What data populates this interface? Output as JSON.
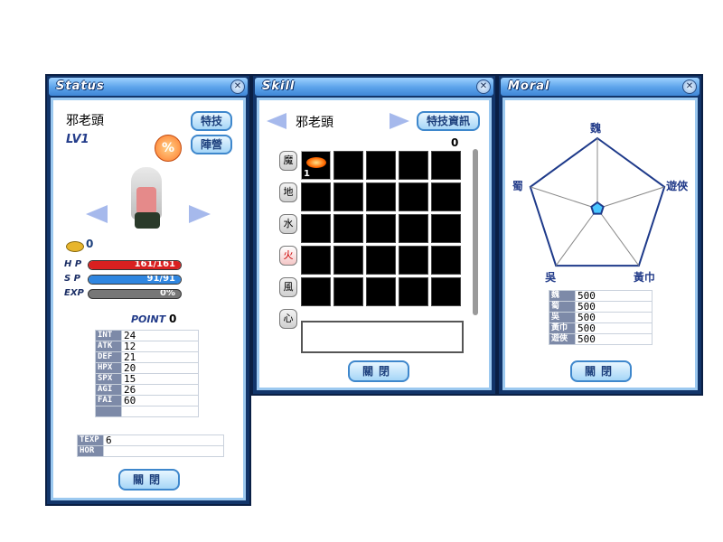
{
  "status": {
    "title": "Status",
    "name": "邪老頭",
    "level": "LV1",
    "btn_special": "特技",
    "btn_camp": "陣營",
    "gold": "0",
    "hp_label": "H P",
    "hp_text": "161/161",
    "hp_ratio": 1.0,
    "sp_label": "S P",
    "sp_text": "91/91",
    "sp_ratio": 1.0,
    "exp_label": "EXP",
    "exp_text": "0%",
    "exp_ratio": 0.0,
    "point_label": "POINT",
    "point_value": "0",
    "stats": [
      {
        "k": "INT",
        "v": "24"
      },
      {
        "k": "ATK",
        "v": "12"
      },
      {
        "k": "DEF",
        "v": "21"
      },
      {
        "k": "HPX",
        "v": "20"
      },
      {
        "k": "SPX",
        "v": "15"
      },
      {
        "k": "AGI",
        "v": "26"
      },
      {
        "k": "FAI",
        "v": "60"
      },
      {
        "k": "",
        "v": ""
      }
    ],
    "texp_label": "TEXP",
    "texp_value": "6",
    "hor_label": "HOR",
    "hor_value": "",
    "close": "關閉"
  },
  "skill": {
    "title": "Skill",
    "name": "邪老頭",
    "btn_info": "特技資訊",
    "count": "0",
    "slot_count": "1",
    "tabs": [
      "魔",
      "地",
      "水",
      "火",
      "風",
      "心"
    ],
    "active_tab": "火",
    "close": "關閉"
  },
  "moral": {
    "title": "Moral",
    "axes": [
      "魏",
      "遊俠",
      "黃巾",
      "吳",
      "蜀"
    ],
    "table": [
      {
        "k": "魏",
        "v": "500"
      },
      {
        "k": "蜀",
        "v": "500"
      },
      {
        "k": "吳",
        "v": "500"
      },
      {
        "k": "黃巾",
        "v": "500"
      },
      {
        "k": "遊俠",
        "v": "500"
      }
    ],
    "close": "關閉"
  },
  "colors": {
    "hp": "#d92020",
    "sp": "#2f86e0",
    "exp": "#8a8a8a",
    "accent": "#3e87cc"
  }
}
